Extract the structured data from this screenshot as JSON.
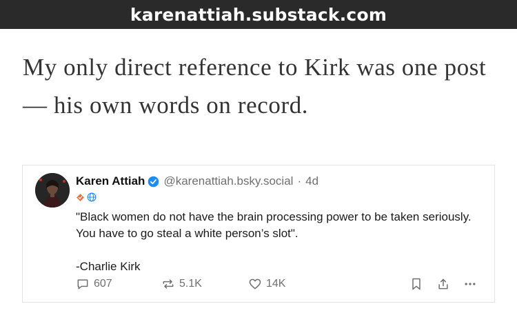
{
  "browser": {
    "url": "karenattiah.substack.com"
  },
  "article": {
    "line_1": "My only direct reference to Kirk was one post",
    "line_2": "— his own words on record."
  },
  "post": {
    "author_name": "Karen Attiah",
    "handle": "@karenattiah.bsky.social",
    "separator": "·",
    "time": "4d",
    "body_line_1": "\"Black women do not have the brain processing power to be taken seriously. You have to go steal a white person’s slot\".",
    "signature": "-Charlie Kirk",
    "replies_count": "607",
    "reposts_count": "5.1K",
    "likes_count": "14K",
    "colors": {
      "verified": "#1d8bf0",
      "badge_orange": "#f26b3a",
      "icon_gray": "#6f6f6f"
    },
    "icons": [
      "verified-icon",
      "orange-badge-icon",
      "globe-icon",
      "reply-icon",
      "repost-icon",
      "like-icon",
      "bookmark-icon",
      "share-icon",
      "more-icon"
    ]
  }
}
